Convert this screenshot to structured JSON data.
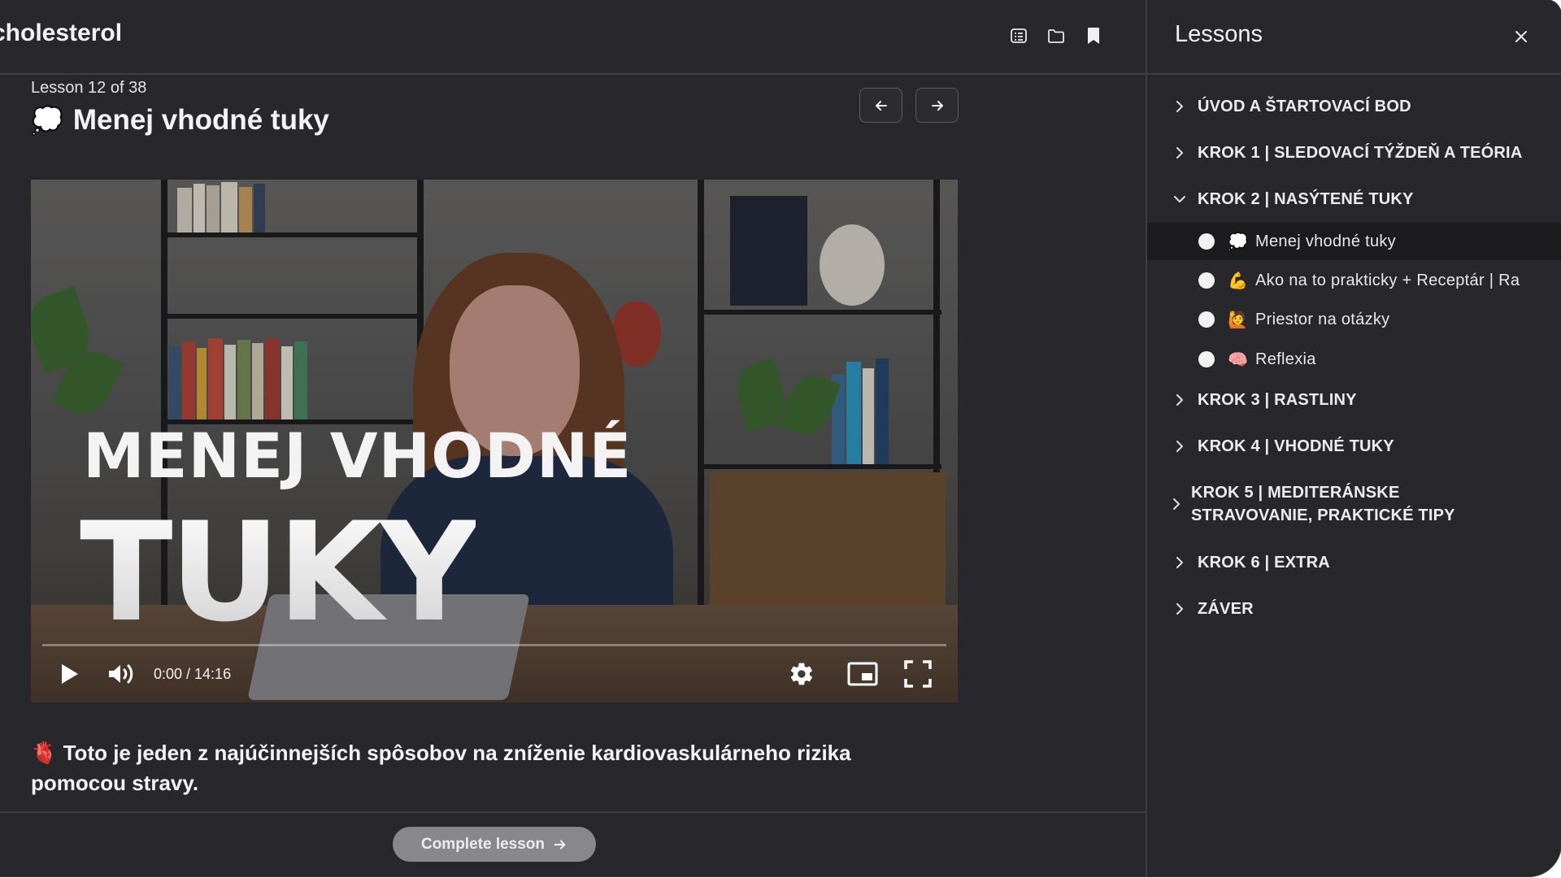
{
  "header": {
    "course_title": "cholesterol",
    "icons": [
      "checklist-icon",
      "folder-icon",
      "bookmark-icon"
    ]
  },
  "lesson": {
    "counter": "Lesson 12 of 38",
    "emoji": "💭",
    "title": "Menej vhodné tuky"
  },
  "video": {
    "overlay_line1": "MENEJ VHODNÉ",
    "overlay_line2": "TUKY",
    "time": "0:00 / 14:16",
    "progress": 0
  },
  "description": {
    "emoji": "🫀",
    "text": "Toto je jeden z najúčinnejších spôsobov na zníženie kardiovaskulárneho rizika pomocou stravy."
  },
  "footer": {
    "complete_label": "Complete lesson"
  },
  "sidebar": {
    "title": "Lessons",
    "sections": [
      {
        "label": "ÚVOD A ŠTARTOVACÍ BOD",
        "expanded": false
      },
      {
        "label": "KROK 1 | SLEDOVACÍ TÝŽDEŇ A TEÓRIA",
        "expanded": false
      },
      {
        "label": "KROK 2 | NASÝTENÉ TUKY",
        "expanded": true
      },
      {
        "label": "KROK 3 | RASTLINY",
        "expanded": false
      },
      {
        "label": "KROK 4 | VHODNÉ TUKY",
        "expanded": false
      },
      {
        "label": "KROK 5 | MEDITERÁNSKE STRAVOVANIE, PRAKTICKÉ TIPY",
        "expanded": false
      },
      {
        "label": "KROK 6 | EXTRA",
        "expanded": false
      },
      {
        "label": "ZÁVER",
        "expanded": false
      }
    ],
    "items": [
      {
        "emoji": "💭",
        "label": "Menej vhodné tuky",
        "active": true
      },
      {
        "emoji": "💪",
        "label": "Ako na to prakticky + Receptár | Ra",
        "active": false
      },
      {
        "emoji": "🙋",
        "label": "Priestor na otázky",
        "active": false
      },
      {
        "emoji": "🧠",
        "label": "Reflexia",
        "active": false
      }
    ]
  },
  "colors": {
    "background": "#28282c",
    "active_row": "#1c1c1f",
    "divider": "#3d3d42",
    "button": "#88888c"
  }
}
